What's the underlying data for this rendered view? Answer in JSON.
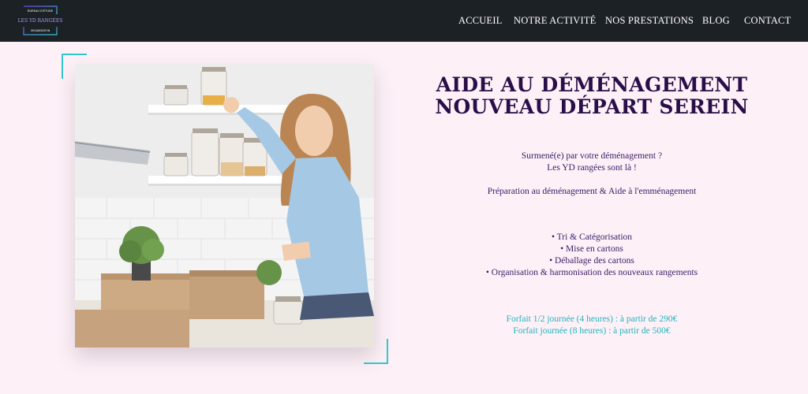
{
  "header": {
    "logo": {
      "top_text": "BUREAU D'ÉTUDE",
      "name": "LES YD RANGÉES",
      "bottom_text": "ORGANISATION"
    },
    "nav": [
      {
        "label": "ACCUEIL"
      },
      {
        "label": "NOTRE ACTIVITÉ"
      },
      {
        "label": "NOS PRESTATIONS"
      },
      {
        "label": "BLOG"
      },
      {
        "label": "CONTACT"
      }
    ]
  },
  "hero": {
    "title_line1": "AIDE AU DÉMÉNAGEMENT",
    "title_line2": "NOUVEAU DÉPART SEREIN",
    "intro_line1": "Surmené(e) par votre déménagement ?",
    "intro_line2": "Les YD rangées sont là !",
    "subtitle": "Préparation au déménagement & Aide à l'emménagement",
    "services": [
      "• Tri & Catégorisation",
      "• Mise en cartons",
      "• Déballage des cartons",
      "• Organisation & harmonisation des nouveaux rangements"
    ],
    "pricing": [
      "Forfait 1/2 journée (4 heures) : à partir de 290€",
      "Forfait journée (8 heures) : à partir de 500€"
    ]
  },
  "colors": {
    "header_bg": "#1c2126",
    "page_bg": "#fdf1f7",
    "title": "#2a0e4a",
    "accent_teal": "#32c7cf"
  }
}
